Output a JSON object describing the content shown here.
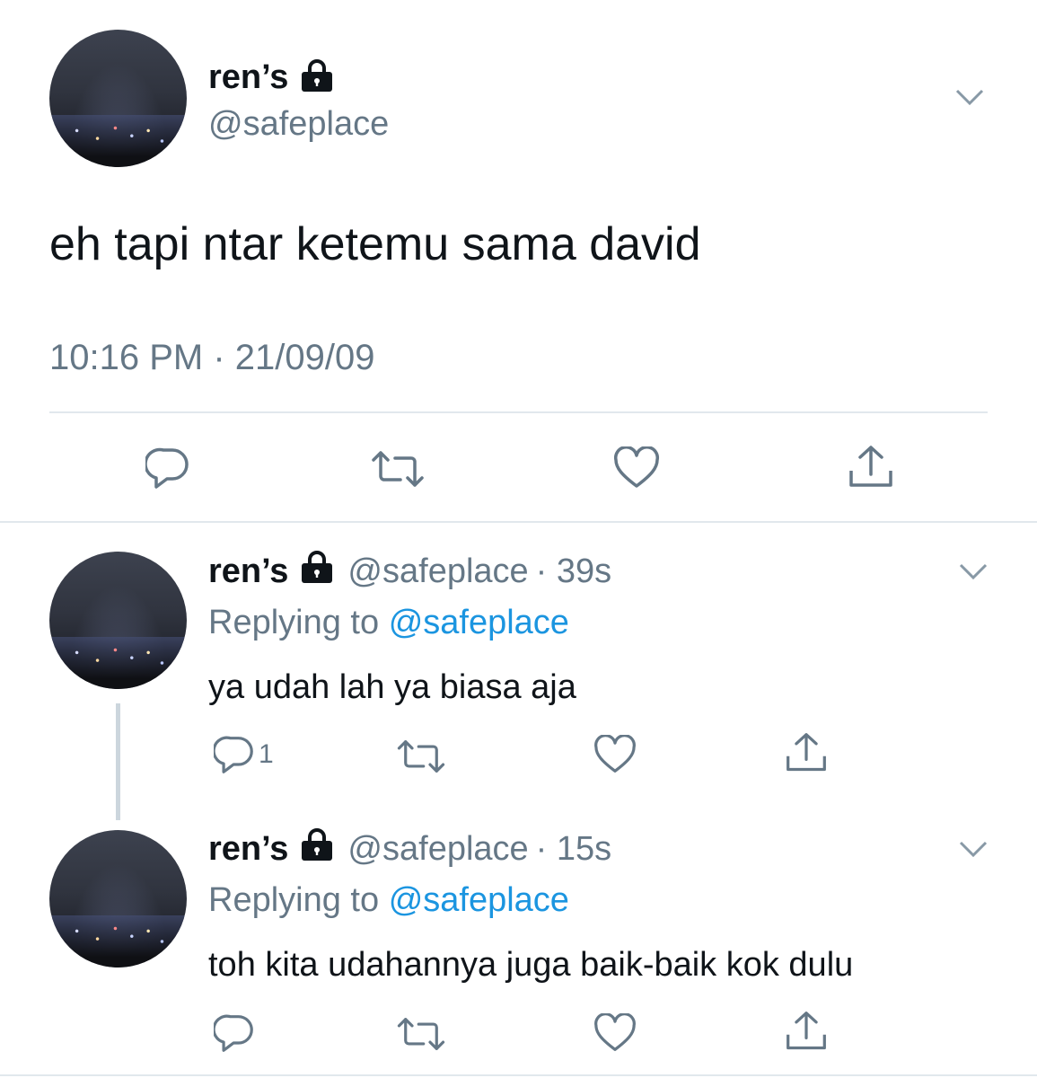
{
  "main_tweet": {
    "name": "ren’s",
    "handle": "@safeplace",
    "text": "eh tapi ntar ketemu sama david",
    "timestamp": "10:16 PM · 21/09/09",
    "actions": [
      "reply-icon",
      "retweet-icon",
      "like-icon",
      "share-icon"
    ]
  },
  "replies": [
    {
      "name": "ren’s",
      "handle": "@safeplace",
      "time": "· 39s",
      "replying_prefix": "Replying to",
      "replying_to": "@safeplace",
      "text": "ya udah lah ya biasa aja",
      "reply_count": "1"
    },
    {
      "name": "ren’s",
      "handle": "@safeplace",
      "time": "· 15s",
      "replying_prefix": "Replying to",
      "replying_to": "@safeplace",
      "text": "toh kita udahannya juga baik-baik kok dulu",
      "reply_count": ""
    }
  ],
  "colors": {
    "text": "#0f1419",
    "secondary": "#657786",
    "link": "#1b95e0",
    "divider": "#e1e8ed"
  }
}
